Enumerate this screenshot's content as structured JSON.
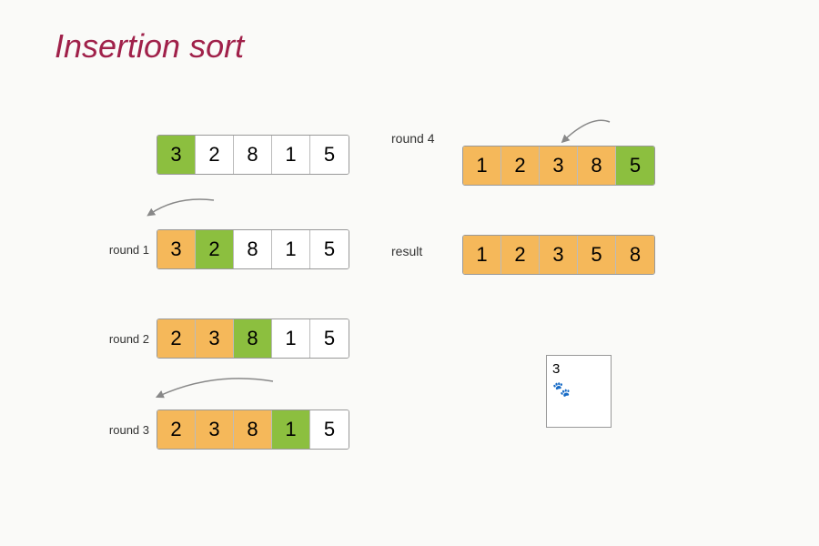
{
  "title": "Insertion sort",
  "rows": {
    "initial": {
      "label": "",
      "cells": [
        {
          "value": "3",
          "type": "green"
        },
        {
          "value": "2",
          "type": "white"
        },
        {
          "value": "8",
          "type": "white"
        },
        {
          "value": "1",
          "type": "white"
        },
        {
          "value": "5",
          "type": "white"
        }
      ]
    },
    "round1": {
      "label": "round 1",
      "cells": [
        {
          "value": "3",
          "type": "orange"
        },
        {
          "value": "2",
          "type": "green"
        },
        {
          "value": "8",
          "type": "white"
        },
        {
          "value": "1",
          "type": "white"
        },
        {
          "value": "5",
          "type": "white"
        }
      ]
    },
    "round2": {
      "label": "round 2",
      "cells": [
        {
          "value": "2",
          "type": "orange"
        },
        {
          "value": "3",
          "type": "orange"
        },
        {
          "value": "8",
          "type": "green"
        },
        {
          "value": "1",
          "type": "white"
        },
        {
          "value": "5",
          "type": "white"
        }
      ]
    },
    "round3": {
      "label": "round 3",
      "cells": [
        {
          "value": "2",
          "type": "orange"
        },
        {
          "value": "3",
          "type": "orange"
        },
        {
          "value": "8",
          "type": "orange"
        },
        {
          "value": "1",
          "type": "green"
        },
        {
          "value": "5",
          "type": "white"
        }
      ]
    },
    "round4": {
      "label": "round 4",
      "cells": [
        {
          "value": "1",
          "type": "orange"
        },
        {
          "value": "2",
          "type": "orange"
        },
        {
          "value": "3",
          "type": "orange"
        },
        {
          "value": "8",
          "type": "orange"
        },
        {
          "value": "5",
          "type": "green"
        }
      ]
    },
    "result": {
      "label": "result",
      "cells": [
        {
          "value": "1",
          "type": "orange"
        },
        {
          "value": "2",
          "type": "orange"
        },
        {
          "value": "3",
          "type": "orange"
        },
        {
          "value": "5",
          "type": "orange"
        },
        {
          "value": "8",
          "type": "orange"
        }
      ]
    }
  },
  "note": {
    "line1": "3",
    "line2": "🐾"
  },
  "arrows": {
    "round1": "curve from cell 2 back to cell 1",
    "round3": "curve from cell 4 back to cell 1",
    "round4": "curve from last cell back"
  }
}
